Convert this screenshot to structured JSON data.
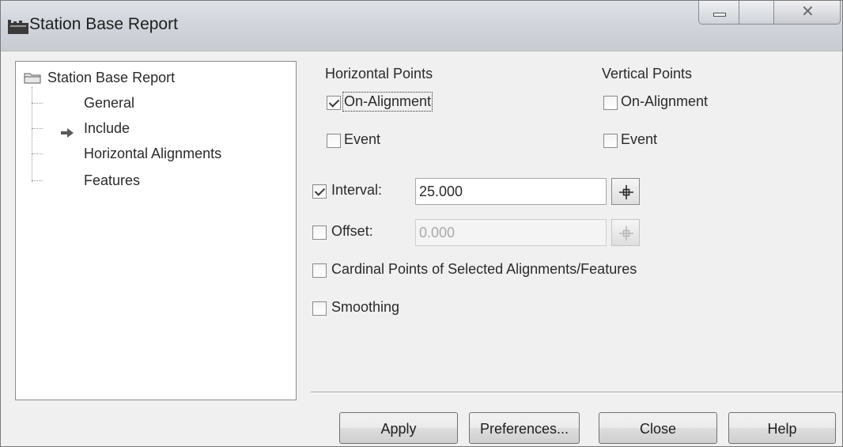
{
  "window": {
    "title": "Station Base Report",
    "icon": "station-report-icon"
  },
  "tree": {
    "root_label": "Station Base Report",
    "items": [
      {
        "label": "General"
      },
      {
        "label": "Include",
        "selected": true
      },
      {
        "label": "Horizontal Alignments"
      },
      {
        "label": "Features"
      }
    ]
  },
  "horizontal_points": {
    "heading": "Horizontal Points",
    "on_alignment_label": "On-Alignment",
    "on_alignment_checked": true,
    "event_label": "Event",
    "event_checked": false
  },
  "vertical_points": {
    "heading": "Vertical Points",
    "on_alignment_label": "On-Alignment",
    "on_alignment_checked": false,
    "event_label": "Event",
    "event_checked": false
  },
  "interval": {
    "label": "Interval:",
    "checked": true,
    "value": "25.000"
  },
  "offset": {
    "label": "Offset:",
    "checked": false,
    "value": "0.000",
    "disabled": true
  },
  "cardinal_points": {
    "label": "Cardinal Points of Selected Alignments/Features",
    "checked": false
  },
  "smoothing": {
    "label": "Smoothing",
    "checked": false
  },
  "buttons": {
    "apply": "Apply",
    "preferences": "Preferences...",
    "close": "Close",
    "help": "Help"
  }
}
